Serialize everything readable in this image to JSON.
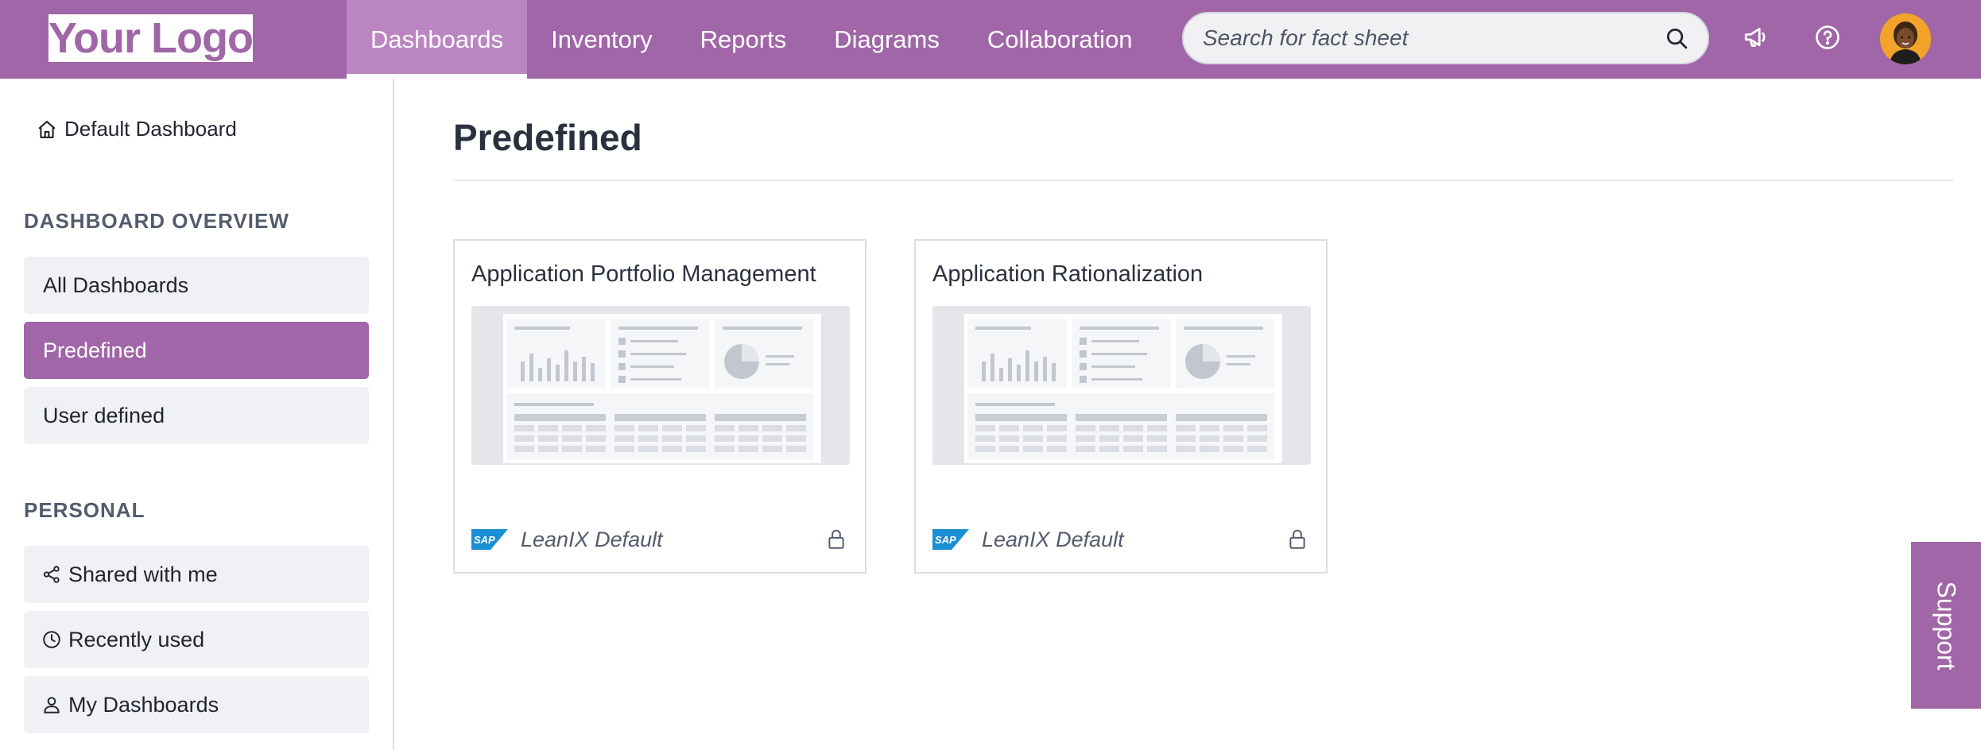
{
  "header": {
    "logo_text": "Your Logo",
    "nav": [
      {
        "label": "Dashboards",
        "active": true
      },
      {
        "label": "Inventory"
      },
      {
        "label": "Reports"
      },
      {
        "label": "Diagrams"
      },
      {
        "label": "Collaboration"
      }
    ],
    "search": {
      "placeholder": "Search for fact sheet",
      "value": ""
    },
    "icons": [
      "megaphone-icon",
      "help-icon",
      "avatar"
    ]
  },
  "sidebar": {
    "default_dashboard": "Default Dashboard",
    "overview_title": "DASHBOARD OVERVIEW",
    "overview_items": [
      {
        "label": "All Dashboards"
      },
      {
        "label": "Predefined",
        "active": true
      },
      {
        "label": "User defined"
      }
    ],
    "personal_title": "PERSONAL",
    "personal_items": [
      {
        "label": "Shared with me",
        "icon": "share-icon"
      },
      {
        "label": "Recently used",
        "icon": "clock-icon"
      },
      {
        "label": "My Dashboards",
        "icon": "user-icon"
      }
    ]
  },
  "main": {
    "title": "Predefined",
    "cards": [
      {
        "title": "Application Portfolio Management",
        "owner": "LeanIX Default",
        "locked": true
      },
      {
        "title": "Application Rationalization",
        "owner": "LeanIX Default",
        "locked": true
      }
    ]
  },
  "support": {
    "label": "Support"
  },
  "colors": {
    "brand": "#a066a7",
    "brand_light": "#bb85c2",
    "text": "#2a303d",
    "muted": "#535b6d"
  }
}
